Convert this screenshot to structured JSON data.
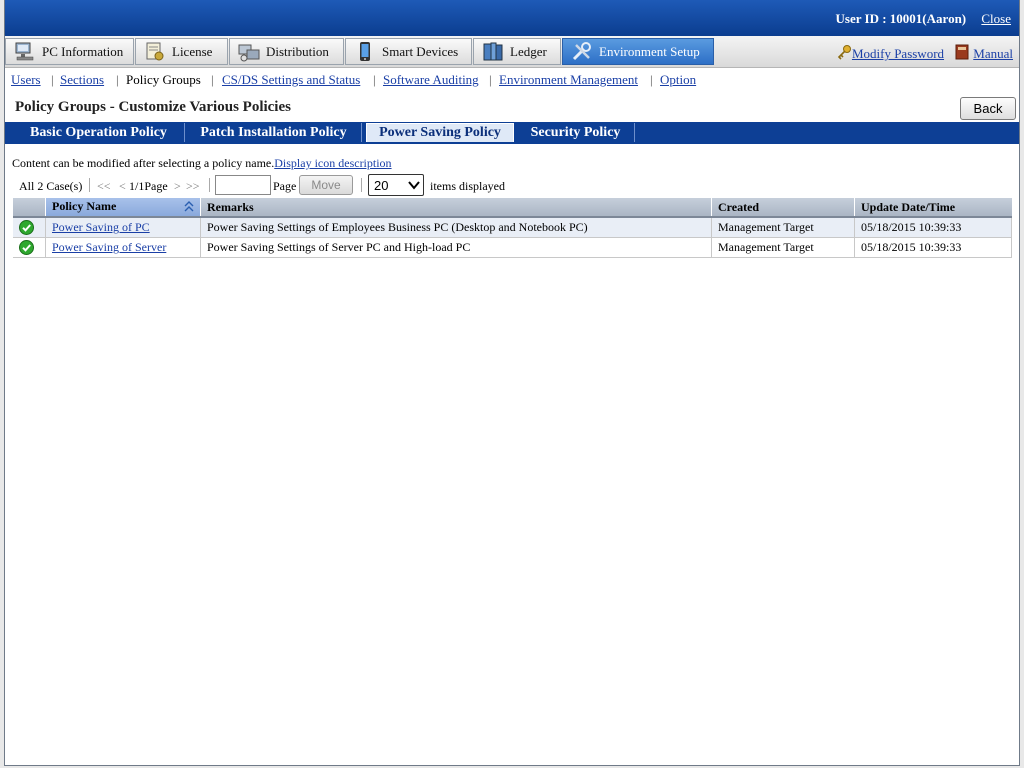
{
  "header": {
    "user_id": "User ID : 10001(Aaron)",
    "close_label": "Close"
  },
  "menu": {
    "tabs": [
      {
        "label": "PC Information",
        "icon": "pc-icon"
      },
      {
        "label": "License",
        "icon": "license-icon"
      },
      {
        "label": "Distribution",
        "icon": "distribution-icon"
      },
      {
        "label": "Smart Devices",
        "icon": "smartphone-icon"
      },
      {
        "label": "Ledger",
        "icon": "ledger-icon"
      },
      {
        "label": "Environment Setup",
        "icon": "tools-icon",
        "active": true
      }
    ],
    "modify_password": "Modify Password",
    "manual": "Manual"
  },
  "submenu": {
    "users": "Users",
    "sections": "Sections",
    "policy_groups": "Policy Groups",
    "csds": "CS/DS Settings and Status",
    "software_auditing": "Software Auditing",
    "env_mgmt": "Environment Management",
    "option": "Option"
  },
  "page": {
    "title": "Policy Groups - Customize Various Policies",
    "back_label": "Back"
  },
  "policy_tabs": {
    "basic": "Basic Operation Policy",
    "patch": "Patch Installation Policy",
    "power": "Power Saving Policy",
    "security": "Security Policy",
    "active": "Power Saving Policy"
  },
  "content": {
    "hint": "Content can be modified after selecting a policy name.",
    "hint_link": "Display icon description"
  },
  "pager": {
    "count": "All 2 Case(s)",
    "first": "<<",
    "prev": "<",
    "page_info": "1/1Page",
    "next": ">",
    "last": ">>",
    "page_label": "Page",
    "page_input_value": "",
    "move_label": "Move",
    "per_page": "20",
    "items_label": "items displayed"
  },
  "table": {
    "headers": {
      "policy_name": "Policy Name",
      "remarks": "Remarks",
      "created": "Created",
      "updated": "Update Date/Time"
    },
    "rows": [
      {
        "name": "Power Saving of PC",
        "remarks": "Power Saving Settings of Employees Business PC (Desktop and Notebook PC)",
        "created": "Management Target",
        "updated": "05/18/2015 10:39:33"
      },
      {
        "name": "Power Saving of Server",
        "remarks": "Power Saving Settings of Server PC and High-load PC",
        "created": "Management Target",
        "updated": "05/18/2015 10:39:33"
      }
    ]
  },
  "colors": {
    "topbar": "#0b3d8f",
    "tab_active": "#2d6fc6",
    "link": "#1a3fa6",
    "status_ok": "#2fa82f"
  }
}
